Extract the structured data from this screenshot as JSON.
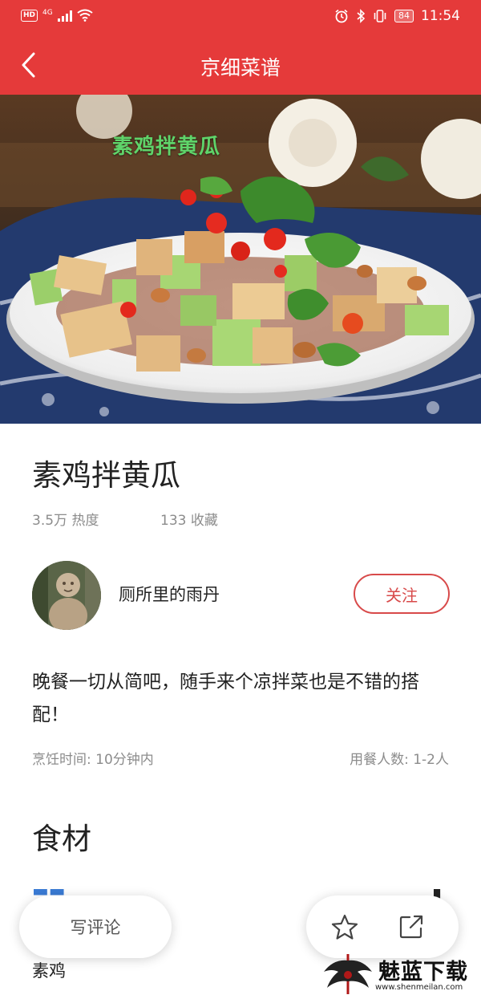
{
  "status_bar": {
    "hd_badge": "HD",
    "network": "4G",
    "battery": "84",
    "time": "11:54"
  },
  "nav": {
    "title": "京细菜谱"
  },
  "hero": {
    "caption": "素鸡拌黄瓜"
  },
  "recipe": {
    "title": "素鸡拌黄瓜",
    "popularity": "3.5万 热度",
    "favorites": "133 收藏",
    "author": "厕所里的雨丹",
    "follow_label": "关注",
    "description": "晚餐一切从简吧，随手来个凉拌菜也是不错的搭配！",
    "cook_time": "烹饪时间: 10分钟内",
    "servings": "用餐人数: 1-2人"
  },
  "ingredients": {
    "heading": "食材",
    "items": [
      "素鸡"
    ]
  },
  "bottom_bar": {
    "comment_label": "写评论"
  },
  "watermark": {
    "text": "魅蓝下载",
    "url": "www.shenmeilan.com"
  },
  "colors": {
    "brand_red": "#e53a3a",
    "follow_red": "#d84a4a"
  }
}
